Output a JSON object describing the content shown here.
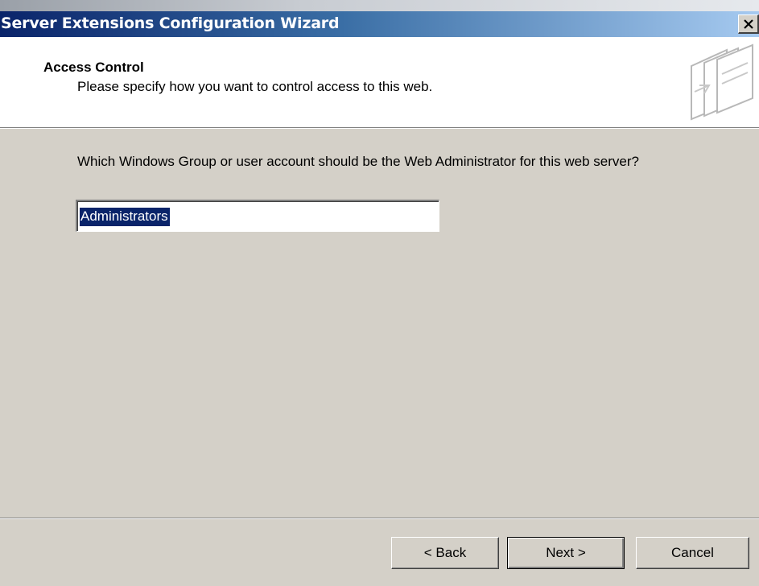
{
  "window": {
    "title": "Server Extensions Configuration Wizard"
  },
  "header": {
    "title": "Access Control",
    "subtitle": "Please specify how you want to control access to this web.",
    "icon": "wizard-pages-icon"
  },
  "main": {
    "question": "Which Windows Group or user account should be the Web Administrator for this web server?",
    "admin_account": {
      "value": "Administrators",
      "selected": true
    }
  },
  "footer": {
    "back_label": "< Back",
    "next_label": "Next >",
    "cancel_label": "Cancel"
  },
  "colors": {
    "titlebar_start": "#0a246a",
    "titlebar_end": "#a6caf0",
    "dialog_face": "#d4d0c8",
    "selection": "#0a246a"
  }
}
